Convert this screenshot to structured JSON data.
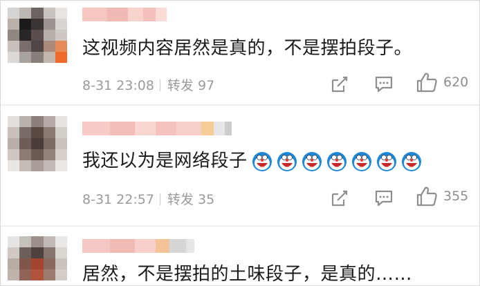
{
  "comments": [
    {
      "text": "这视频内容居然是真的，不是摆拍段子。",
      "time": "8-31 23:08",
      "repost_label": "转发",
      "repost_count": "97",
      "like_count": "620",
      "emoji_count": 0
    },
    {
      "text": "我还以为是网络段子",
      "time": "8-31 22:57",
      "repost_label": "转发",
      "repost_count": "35",
      "like_count": "355",
      "emoji": "doraemon-laugh-icon",
      "emoji_count": 7
    },
    {
      "text": "居然，不是摆拍的土味段子，是真的……"
    }
  ],
  "colors": {
    "meta_text": "#9a9a9a",
    "icon": "#8e8e8e",
    "doraemon_blue": "#1e88d8"
  }
}
